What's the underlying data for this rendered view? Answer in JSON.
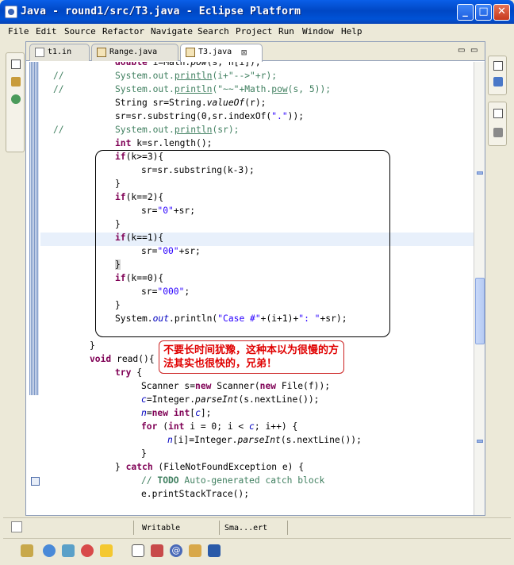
{
  "window": {
    "title": "Java - round1/src/T3.java - Eclipse Platform",
    "minimize_label": "_",
    "maximize_label": "□",
    "close_label": "✕"
  },
  "menu": [
    "File",
    "Edit",
    "Source",
    "Refactor",
    "Navigate",
    "Search",
    "Project",
    "Run",
    "Window",
    "Help"
  ],
  "tabs": [
    {
      "label": "t1.in",
      "icon": "file-icon",
      "active": false
    },
    {
      "label": "Range.java",
      "icon": "java-file-icon",
      "active": false
    },
    {
      "label": "T3.java",
      "icon": "java-file-icon",
      "active": true
    }
  ],
  "tab_close_label": "⊠",
  "tab_controls": {
    "minimize": "▭",
    "maximize": "▭"
  },
  "code_lines": [
    [
      "double i=Math.pow(s, n[i]);"
    ],
    [
      "//",
      "System.out.println(i+\"-->\"+r);"
    ],
    [
      "//",
      "System.out.println(\"~~\"+Math.pow(s, 5));"
    ],
    [
      "String sr=String.valueOf(r);"
    ],
    [
      "sr=sr.substring(0,sr.indexOf(\".\"));"
    ],
    [
      "//",
      "System.out.println(sr);"
    ],
    [
      "int k=sr.length();"
    ],
    [
      "if(k>=3){"
    ],
    [
      "sr=sr.substring(k-3);"
    ],
    [
      "}"
    ],
    [
      "if(k==2){"
    ],
    [
      "sr=\"0\"+sr;"
    ],
    [
      "}"
    ],
    [
      "if(k==1){"
    ],
    [
      "sr=\"00\"+sr;"
    ],
    [
      "}"
    ],
    [
      "if(k==0){"
    ],
    [
      "sr=\"000\";"
    ],
    [
      "}"
    ],
    [
      "System.out.println(\"Case #\"+(i+1)+\": \"+sr);"
    ],
    [
      ""
    ],
    [
      "}"
    ],
    [
      "void read(){"
    ],
    [
      "try {"
    ],
    [
      "Scanner s=new Scanner(new File(f));"
    ],
    [
      "c=Integer.parseInt(s.nextLine());"
    ],
    [
      "n=new int[c];"
    ],
    [
      "for (int i = 0; i < c; i++) {"
    ],
    [
      "n[i]=Integer.parseInt(s.nextLine());"
    ],
    [
      "}"
    ],
    [
      "} catch (FileNotFoundException e) {"
    ],
    [
      "// TODO Auto-generated catch block"
    ],
    [
      "e.printStackTrace();"
    ]
  ],
  "annotation": "不要长时间犹豫，这种本以为很慢的方法其实也很快的，兄弟！",
  "status": {
    "writable": "Writable",
    "insert_mode": "Sma...ert"
  }
}
